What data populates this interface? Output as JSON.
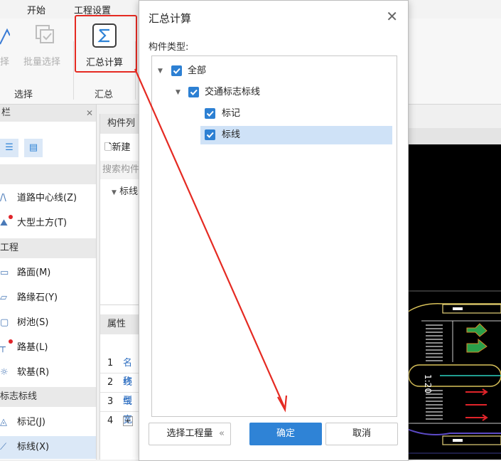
{
  "menubar": {
    "items": [
      "开始",
      "工程设置"
    ]
  },
  "ribbon": {
    "select_partial": "择",
    "batch_select": "批量选择",
    "sum_calc": "汇总计算",
    "groups": [
      "选择",
      "汇总"
    ]
  },
  "left_panel": {
    "header": "栏",
    "sections": [
      {
        "label": "",
        "items": [
          {
            "label": "道路中心线(Z)",
            "icon": "road-centerline-icon"
          },
          {
            "label": "大型土方(T)",
            "icon": "earthwork-icon",
            "badge": true
          }
        ]
      },
      {
        "label": "工程",
        "items": [
          {
            "label": "路面(M)",
            "icon": "pavement-icon"
          },
          {
            "label": "路缘石(Y)",
            "icon": "curb-icon"
          },
          {
            "label": "树池(S)",
            "icon": "tree-pit-icon"
          },
          {
            "label": "路基(L)",
            "icon": "subgrade-icon",
            "badge": true
          },
          {
            "label": "软基(R)",
            "icon": "soft-foundation-icon"
          }
        ]
      },
      {
        "label": "标志标线",
        "items": [
          {
            "label": "标记(J)",
            "icon": "marker-icon"
          },
          {
            "label": "标线(X)",
            "icon": "line-icon",
            "selected": true
          }
        ]
      }
    ]
  },
  "middle_panel": {
    "title": "构件列",
    "new_btn": "新建",
    "search": "搜索构件",
    "tree_node": "标线",
    "prop_header": "属性",
    "rows": [
      {
        "num": "1",
        "text": "名称"
      },
      {
        "num": "2",
        "text": "线型"
      },
      {
        "num": "3",
        "text": "线宽"
      },
      {
        "num": "4",
        "text": "+"
      }
    ]
  },
  "dialog": {
    "title": "汇总计算",
    "label": "构件类型:",
    "tree": [
      {
        "label": "全部",
        "checked": true,
        "level": 0,
        "expanded": true
      },
      {
        "label": "交通标志标线",
        "checked": true,
        "level": 1,
        "expanded": true
      },
      {
        "label": "标记",
        "checked": true,
        "level": 2
      },
      {
        "label": "标线",
        "checked": true,
        "level": 2,
        "selected": true
      }
    ],
    "select_project_btn": "选择工程量",
    "ok_btn": "确定",
    "cancel_btn": "取消"
  },
  "cad": {
    "road_label": "1:20"
  },
  "colors": {
    "accent": "#2f83d6",
    "annotation": "#e52a22",
    "selection": "#cfe2f7",
    "cad_bg": "#000000"
  }
}
